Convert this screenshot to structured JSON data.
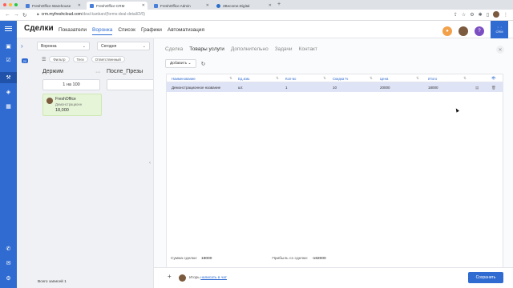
{
  "browser": {
    "tabs": [
      {
        "label": "FreshOffice Warehouse"
      },
      {
        "label": "FreshOffice CRM"
      },
      {
        "label": "FreshOffice Admin"
      },
      {
        "label": "2Become.Digital"
      }
    ],
    "url_host": "crm.myfreshcloud.com",
    "url_path": "/deal-kanban/(forms:deal-detail/2/0)"
  },
  "header": {
    "title": "Сделки",
    "tabs": [
      "Показатели",
      "Воронка",
      "Список",
      "Графики",
      "Автоматизация"
    ],
    "active_tab": "Воронка",
    "crm_badge": "CRM"
  },
  "kanban": {
    "badge": "20",
    "funnel_select": "Воронка",
    "date_select": "Сегодня",
    "filters": [
      "Фильтр",
      "Теги",
      "Ответственный"
    ],
    "columns": [
      {
        "title": "Держим",
        "count": "1 на 100"
      },
      {
        "title": "После_Презы",
        "count": ""
      }
    ],
    "card": {
      "name": "FreshOffice",
      "subtitle": "Демонстрационн",
      "amount": "18,000"
    },
    "total_records": "Всего записей 1"
  },
  "panel": {
    "tabs": [
      "Сделка",
      "Товары услуги",
      "Дополнительно",
      "Задачи",
      "Контакт"
    ],
    "active_tab": "Товары услуги",
    "add_button": "Добавить",
    "grid": {
      "columns": [
        "Наименование",
        "Ед.изм.",
        "Кол-во",
        "Скидка %",
        "Цена",
        "Итого"
      ],
      "rows": [
        [
          "Демонстрационное название",
          "шт.",
          "1",
          "10",
          "20000",
          "18000"
        ]
      ]
    },
    "sum_label": "Сумма сделки:",
    "sum_value": "18000",
    "profit_label": "Прибыль со сделки:",
    "profit_value": "-182000",
    "chat_user": "Игорь",
    "chat_link": "написать в чат",
    "save_button": "Сохранить"
  }
}
